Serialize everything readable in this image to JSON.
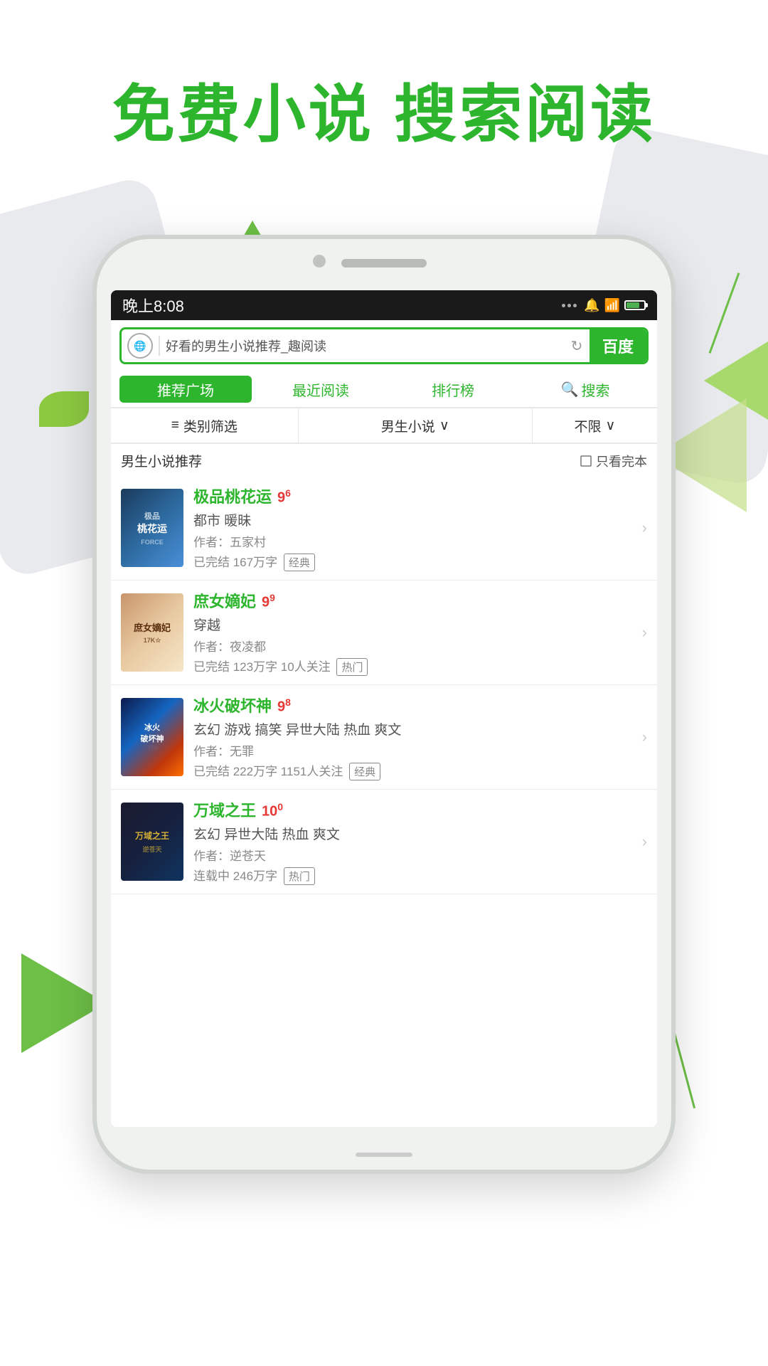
{
  "page": {
    "title": "免费小说  搜索阅读"
  },
  "statusBar": {
    "time": "晚上8:08"
  },
  "searchBar": {
    "query": "好看的男生小说推荐_趣阅读",
    "button": "百度"
  },
  "navTabs": [
    {
      "id": "recommend",
      "label": "推荐广场",
      "active": true
    },
    {
      "id": "recent",
      "label": "最近阅读",
      "active": false
    },
    {
      "id": "ranking",
      "label": "排行榜",
      "active": false
    },
    {
      "id": "search",
      "label": "搜索",
      "active": false
    }
  ],
  "filters": [
    {
      "id": "category",
      "label": "类别筛选",
      "icon": "≡"
    },
    {
      "id": "gender",
      "label": "男生小说",
      "arrow": "∨"
    },
    {
      "id": "limit",
      "label": "不限",
      "arrow": "∨"
    }
  ],
  "sectionHeader": {
    "title": "男生小说推荐",
    "checkboxLabel": "只看完本"
  },
  "books": [
    {
      "id": 1,
      "title": "极品桃花运",
      "rating": "9",
      "ratingSup": "6",
      "genre": "都市 暖昧",
      "author": "作者：五家村",
      "stats": "已完结 167万字",
      "tag": "经典",
      "coverStyle": "cover-1",
      "coverText": "极品\n桃花运"
    },
    {
      "id": 2,
      "title": "庶女嫡妃",
      "rating": "9",
      "ratingSup": "9",
      "genre": "穿越",
      "author": "作者：夜凌都",
      "stats": "已完结 123万字 10人关注",
      "tag": "热门",
      "coverStyle": "cover-2",
      "coverText": "庶女嫡妃"
    },
    {
      "id": 3,
      "title": "冰火破坏神",
      "rating": "9",
      "ratingSup": "8",
      "genre": "玄幻 游戏 搞笑 异世大陆 热血 爽文",
      "author": "作者：无罪",
      "stats": "已完结 222万字 1151人关注",
      "tag": "经典",
      "coverStyle": "cover-3",
      "coverText": "冰火破坏神"
    },
    {
      "id": 4,
      "title": "万域之王",
      "rating": "10",
      "ratingSup": "0",
      "genre": "玄幻 异世大陆 热血 爽文",
      "author": "作者：逆苍天",
      "stats": "连载中 246万字",
      "tag": "热门",
      "coverStyle": "cover-4",
      "coverText": "万域之王"
    }
  ]
}
